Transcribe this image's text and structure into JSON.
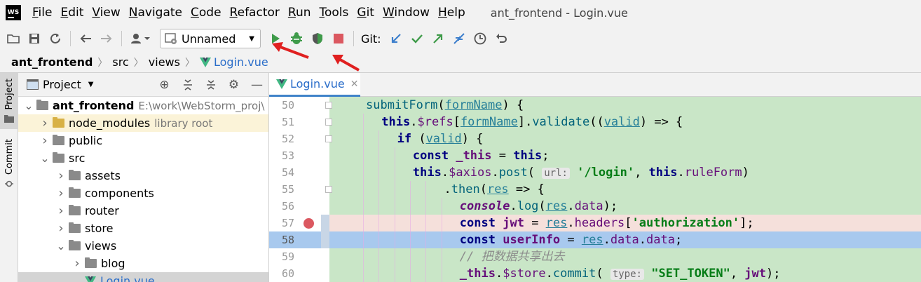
{
  "window": {
    "title": "ant_frontend - Login.vue"
  },
  "menu": [
    {
      "m": "F",
      "rest": "ile"
    },
    {
      "m": "E",
      "rest": "dit"
    },
    {
      "m": "V",
      "rest": "iew"
    },
    {
      "m": "N",
      "rest": "avigate"
    },
    {
      "m": "C",
      "rest": "ode"
    },
    {
      "m": "R",
      "rest": "efactor"
    },
    {
      "m": "R",
      "rest": "un"
    },
    {
      "m": "T",
      "rest": "ools"
    },
    {
      "m": "G",
      "rest": "it"
    },
    {
      "m": "W",
      "rest": "indow"
    },
    {
      "m": "H",
      "rest": "elp"
    }
  ],
  "toolbar": {
    "run_config": "Unnamed",
    "git_label": "Git:"
  },
  "breadcrumb": {
    "project": "ant_frontend",
    "dir1": "src",
    "dir2": "views",
    "file": "Login.vue"
  },
  "sidebar": {
    "project_tab": "Project",
    "commit_tab": "Commit"
  },
  "project_panel": {
    "title": "Project",
    "tree": [
      {
        "name": "ant_frontend",
        "hint": "E:\\work\\WebStorm_proj\\",
        "bold": true,
        "depth": 0,
        "open": true
      },
      {
        "name": "node_modules",
        "hint": "library root",
        "depth": 1,
        "open": false,
        "excluded": true
      },
      {
        "name": "public",
        "depth": 1,
        "open": false
      },
      {
        "name": "src",
        "depth": 1,
        "open": true
      },
      {
        "name": "assets",
        "depth": 2,
        "open": false
      },
      {
        "name": "components",
        "depth": 2,
        "open": false
      },
      {
        "name": "router",
        "depth": 2,
        "open": false
      },
      {
        "name": "store",
        "depth": 2,
        "open": false
      },
      {
        "name": "views",
        "depth": 2,
        "open": true
      },
      {
        "name": "blog",
        "depth": 3,
        "open": false
      },
      {
        "name": "Login.vue",
        "depth": 3,
        "file": true,
        "selected": true
      }
    ]
  },
  "editor": {
    "tab": "Login.vue",
    "lines": [
      {
        "n": "50",
        "fold": true,
        "indent": 2,
        "tokens": [
          [
            "mth",
            "submitForm"
          ],
          [
            "",
            "("
          ],
          [
            "par",
            "formName"
          ],
          [
            "",
            ") {"
          ]
        ]
      },
      {
        "n": "51",
        "fold": true,
        "indent": 3,
        "tokens": [
          [
            "kw",
            "this"
          ],
          [
            "",
            "."
          ],
          [
            "prop",
            "$refs"
          ],
          [
            "",
            "["
          ],
          [
            "par",
            "formName"
          ],
          [
            "",
            "]."
          ],
          [
            "mth",
            "validate"
          ],
          [
            "",
            "(("
          ],
          [
            "par",
            "valid"
          ],
          [
            "",
            ") => {"
          ]
        ]
      },
      {
        "n": "52",
        "fold": true,
        "indent": 4,
        "tokens": [
          [
            "kw",
            "if"
          ],
          [
            "",
            " ("
          ],
          [
            "par",
            "valid"
          ],
          [
            "",
            ") {"
          ]
        ]
      },
      {
        "n": "53",
        "indent": 5,
        "tokens": [
          [
            "kw",
            "const"
          ],
          [
            "",
            " "
          ],
          [
            "var",
            "_this"
          ],
          [
            "",
            " = "
          ],
          [
            "kw",
            "this"
          ],
          [
            "",
            ";"
          ]
        ]
      },
      {
        "n": "54",
        "indent": 5,
        "tokens": [
          [
            "kw",
            "this"
          ],
          [
            "",
            "."
          ],
          [
            "prop",
            "$axios"
          ],
          [
            "",
            "."
          ],
          [
            "mth",
            "post"
          ],
          [
            "",
            "( "
          ],
          [
            "hint",
            "url:"
          ],
          [
            "",
            " "
          ],
          [
            "str",
            "'/login'"
          ],
          [
            "",
            ", "
          ],
          [
            "kw",
            "this"
          ],
          [
            "",
            "."
          ],
          [
            "prop",
            "ruleForm"
          ],
          [
            "",
            ")"
          ]
        ]
      },
      {
        "n": "55",
        "fold": true,
        "indent": 7,
        "tokens": [
          [
            "",
            "."
          ],
          [
            "mth",
            "then"
          ],
          [
            "",
            "("
          ],
          [
            "par",
            "res"
          ],
          [
            "",
            " => {"
          ]
        ]
      },
      {
        "n": "56",
        "indent": 8,
        "tokens": [
          [
            "it",
            "console"
          ],
          [
            "",
            "."
          ],
          [
            "mth",
            "log"
          ],
          [
            "",
            "("
          ],
          [
            "par",
            "res"
          ],
          [
            "",
            "."
          ],
          [
            "prop",
            "data"
          ],
          [
            "",
            ");"
          ]
        ]
      },
      {
        "n": "57",
        "breakpoint": true,
        "indent": 8,
        "tokens": [
          [
            "kw",
            "const"
          ],
          [
            "",
            " "
          ],
          [
            "var",
            "jwt"
          ],
          [
            "",
            " = "
          ],
          [
            "par",
            "res"
          ],
          [
            "",
            "."
          ],
          [
            "prop",
            "headers"
          ],
          [
            "",
            "["
          ],
          [
            "str",
            "'authorization'"
          ],
          [
            "",
            "];"
          ]
        ]
      },
      {
        "n": "58",
        "current": true,
        "indent": 8,
        "tokens": [
          [
            "kw",
            "const"
          ],
          [
            "",
            " "
          ],
          [
            "var",
            "userInfo"
          ],
          [
            "",
            " = "
          ],
          [
            "par",
            "res"
          ],
          [
            "",
            "."
          ],
          [
            "prop",
            "data"
          ],
          [
            "",
            "."
          ],
          [
            "prop",
            "data"
          ],
          [
            "",
            ";"
          ]
        ]
      },
      {
        "n": "59",
        "indent": 8,
        "tokens": [
          [
            "cmt",
            "// 把数据共享出去"
          ]
        ]
      },
      {
        "n": "60",
        "indent": 8,
        "tokens": [
          [
            "var",
            "_this"
          ],
          [
            "",
            "."
          ],
          [
            "prop",
            "$store"
          ],
          [
            "",
            "."
          ],
          [
            "mth",
            "commit"
          ],
          [
            "",
            "( "
          ],
          [
            "hint",
            "type:"
          ],
          [
            "",
            " "
          ],
          [
            "str",
            "\"SET_TOKEN\""
          ],
          [
            "",
            ", "
          ],
          [
            "var",
            "jwt"
          ],
          [
            "",
            ");"
          ]
        ]
      }
    ]
  }
}
